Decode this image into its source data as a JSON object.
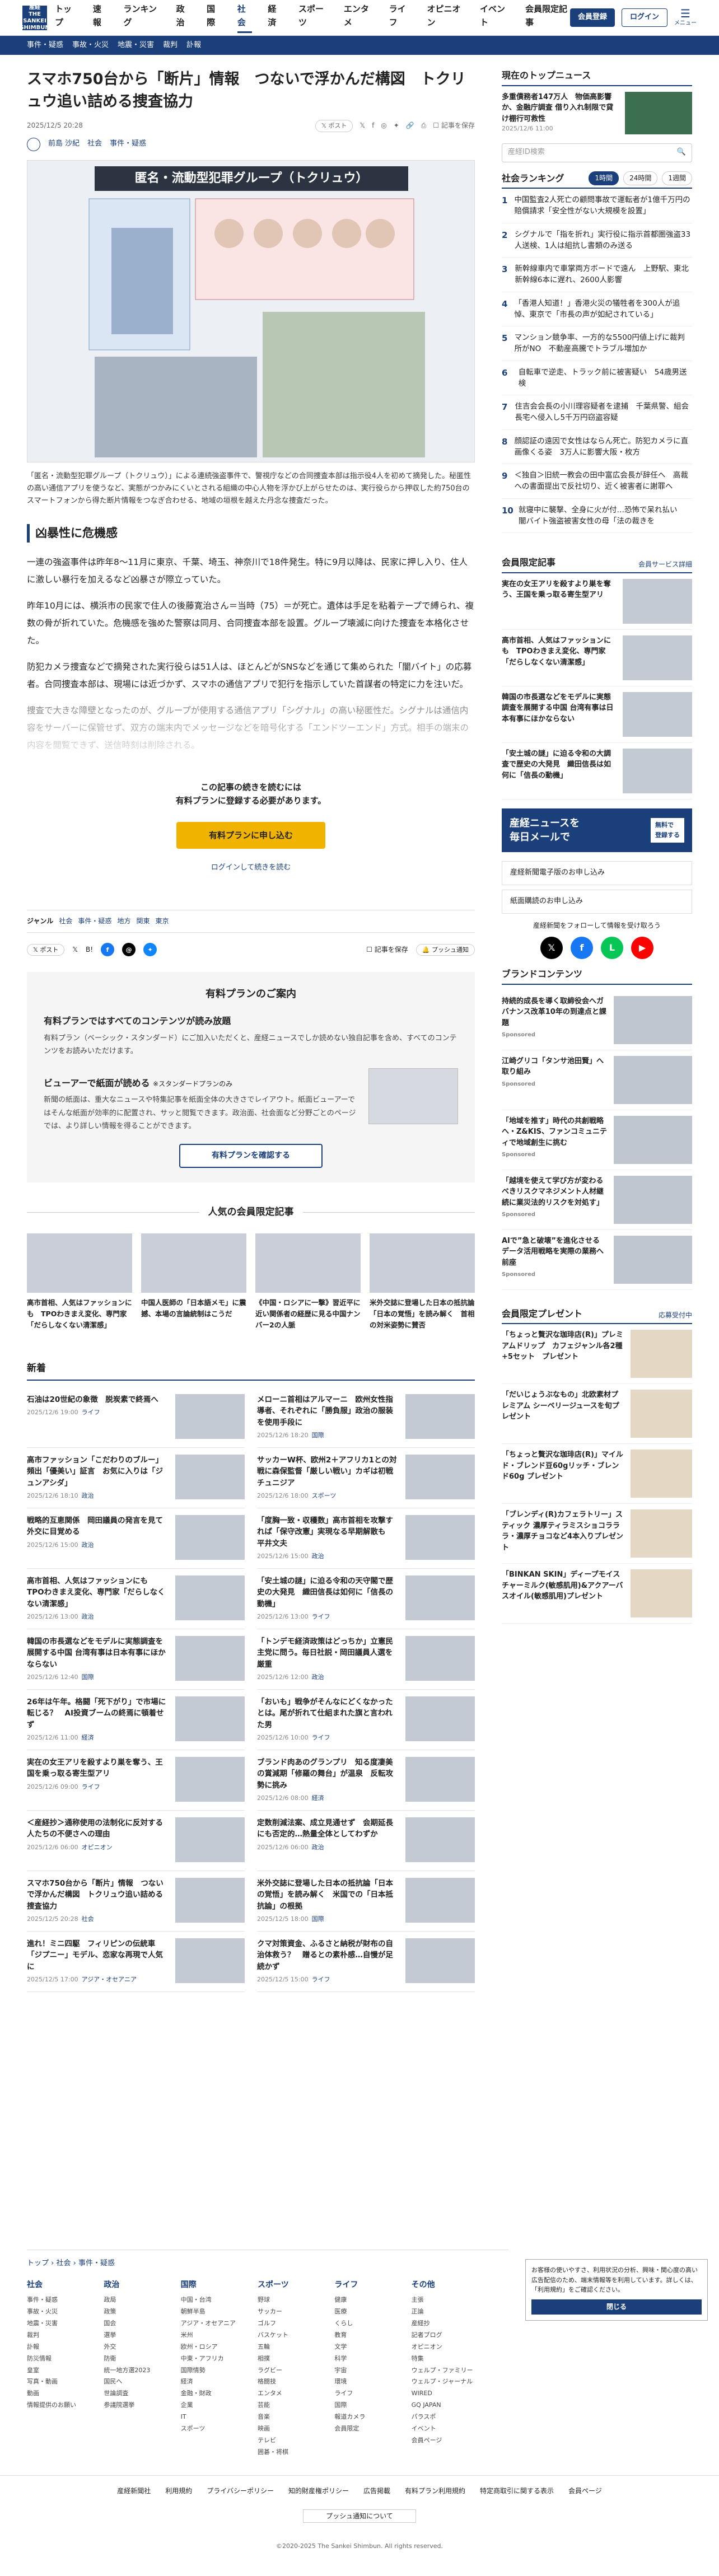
{
  "header": {
    "logo": "産経\nTHE SANKEI\nSHIMBUN",
    "nav": [
      "トップ",
      "速報",
      "ランキング",
      "政治",
      "国際",
      "社会",
      "経済",
      "スポーツ",
      "エンタメ",
      "ライフ",
      "オピニオン",
      "イベント",
      "会員限定記事"
    ],
    "current": "社会",
    "member_btn": "会員登録",
    "login_btn": "ログイン",
    "menu": "メニュー"
  },
  "subnav": [
    "事件・疑惑",
    "事故・火災",
    "地震・災害",
    "裁判",
    "訃報"
  ],
  "article": {
    "title": "スマホ750台から「断片」情報　つないで浮かんだ構図　トクリュウ追い詰める捜査協力",
    "date": "2025/12/5 20:28",
    "share": {
      "post": "ポスト",
      "save": "記事を保存"
    },
    "author": "前島 沙紀",
    "cats": [
      "社会",
      "事件・疑惑"
    ],
    "figure": {
      "banner": "匿名・流動型犯罪グループ（トクリュウ）",
      "caption": "「匿名・流動型犯罪グループ（トクリュウ）」による連続強盗事件で、警視庁などの合同捜査本部は指示役4人を初めて摘発した。秘匿性の高い通信アプリを使うなど、実態がつかみにくいとされる組織の中心人物を浮かび上がらせたのは、実行役らから押収した約750台のスマートフォンから得た断片情報をつなぎ合わせる、地域の垣根を越えた丹念な捜査だった。"
    },
    "h2": "凶暴性に危機感",
    "paras": [
      "一連の強盗事件は昨年8～11月に東京、千葉、埼玉、神奈川で18件発生。特に9月以降は、民家に押し入り、住人に激しい暴行を加えるなど凶暴さが際立っていた。",
      "昨年10月には、横浜市の民家で住人の後藤寛治さん＝当時（75）＝が死亡。遺体は手足を粘着テープで縛られ、複数の骨が折れていた。危機感を強めた警察は同月、合同捜査本部を設置。グループ壊滅に向けた捜査を本格化させた。",
      "防犯カメラ捜査などで摘発された実行役らは51人は、ほとんどがSNSなどを通じて集められた「闇バイト」の応募者。合同捜査本部は、現場には近づかず、スマホの通信アプリで犯行を指示していた首謀者の特定に力を注いだ。",
      "捜査で大きな障壁となったのが、グループが使用する通信アプリ「シグナル」の高い秘匿性だ。シグナルは通信内容をサーバーに保管せず、双方の端末内でメッセージなどを暗号化する「エンドツーエンド」方式。相手の端末の内容を閲覧できず、送信時刻は削除される。"
    ],
    "paywall": {
      "msg1": "この記事の続きを読むには",
      "msg2": "有料プランに登録する必要があります。",
      "btn": "有料プランに申し込む",
      "link": "ログインして続きを読む"
    },
    "genre": {
      "label": "ジャンル",
      "items": [
        "社会",
        "事件・疑惑",
        "地方",
        "関東",
        "東京"
      ]
    },
    "bshare": {
      "post": "ポスト",
      "save": "記事を保存",
      "flash": "プッシュ通知"
    }
  },
  "plan": {
    "title": "有料プランのご案内",
    "h1": "有料プランではすべてのコンテンツが読み放題",
    "p1": "有料プラン（ベーシック・スタンダード）にご加入いただくと、産経ニュースでしか読めない独自記事を含め、すべてのコンテンツをお読みいただけます。",
    "h2": "ビューアーで紙面が読める",
    "h2note": "※スタンダードプランのみ",
    "p2": "新聞の紙面は、重大なニュースや特集記事を紙面全体の大きさでレイアウト。紙面ビューアーではそんな紙面が効率的に配置され、サッと閲覧できます。政治面、社会面など分野ごとのページでは、より詳しい情報を得ることができます。",
    "btn": "有料プランを確認する"
  },
  "popular": {
    "title": "人気の会員限定記事",
    "items": [
      "高市首相、人気はファッションにも　TPOわきまえ変化、専門家「だらしなくない清潔感」",
      "中国人医師の「日本語メモ」に震撼、本場の言論統制はこうだ",
      "《中国・ロシアに一撃》習近平に近い関係者の経歴に見る中国ナンバー2の人脈",
      "米外交誌に登場した日本の抵抗論「日本の覚悟」を読み解く　首相の対米姿勢に賛否"
    ]
  },
  "news": {
    "title": "新着",
    "items": [
      {
        "t": "石油は20世紀の象徴　脱炭素で終焉へ",
        "d": "2025/12/6 19:00",
        "c": "ライフ"
      },
      {
        "t": "メローニ首相はアルマーニ　欧州女性指導者、それぞれに「勝負服」政治の服装を使用手段に",
        "d": "2025/12/6 18:20",
        "c": "国際"
      },
      {
        "t": "高市ファッション「こだわりのブルー」頻出「優美い」証言　お気に入りは「ジュンアシダ」",
        "d": "2025/12/6 18:10",
        "c": "政治"
      },
      {
        "t": "サッカーW杯、欧州2＋アフリカ1との対戦に森保監督「厳しい戦い」カギは初戦チュニジア",
        "d": "2025/12/6 18:00",
        "c": "スポーツ"
      },
      {
        "t": "戦略的互恵関係　岡田議員の発言を見て外交に目覚める",
        "d": "2025/12/6 15:00",
        "c": "政治"
      },
      {
        "t": "「度胸一致・収穫数」高市首相を攻撃すれば「保守改憲」実現なる早期解散も　平井文夫",
        "d": "2025/12/6 15:00",
        "c": "政治"
      },
      {
        "t": "高市首相、人気はファッションにも　TPOわきまえ変化、専門家「だらしなくない清潔感」",
        "d": "2025/12/6 13:00",
        "c": "政治"
      },
      {
        "t": "「安土城の謎」に迫る令和の天守閣で歴史の大発見　織田信長は如何に「信長の動機」",
        "d": "2025/12/6 13:00",
        "c": "ライフ"
      },
      {
        "t": "韓国の市長選などをモデルに実態調査を展開する中国 台湾有事は日本有事にほかならない",
        "d": "2025/12/6 12:40",
        "c": "国際"
      },
      {
        "t": "「トンデモ経済政策はどっちか」立憲民主党に問う。毎日社説・岡田議員人選を厳重",
        "d": "2025/12/6 12:00",
        "c": "政治"
      },
      {
        "t": "26年は午年。格闘「死下がり」で市場に転じる？　AI投資ブームの終焉に頓着せず",
        "d": "2025/12/6 11:00",
        "c": "経済"
      },
      {
        "t": "「おいも」戦争がそんなにどくなかったとは。尾が折れて仕組まれた旗と言われた男",
        "d": "2025/12/6 10:00",
        "c": "ライフ"
      },
      {
        "t": "実在の女王アリを殺すより巣を奪う、王国を乗っ取る寄生型アリ",
        "d": "2025/12/6 09:00",
        "c": "ライフ"
      },
      {
        "t": "ブランド肉あのグランプリ　知る度凄美の賞減期「修羅の舞台」が温泉　反転攻勢に挑み",
        "d": "2025/12/6 08:00",
        "c": "経済"
      },
      {
        "t": "＜産経抄＞通称使用の法制化に反対する人たちの不便さへの理由",
        "d": "2025/12/6 06:00",
        "c": "オピニオン"
      },
      {
        "t": "定数削減法案、成立見通せず　会期延長にも否定的…熱量全体としてわずか",
        "d": "2025/12/6 06:00",
        "c": "政治"
      },
      {
        "t": "スマホ750台から「断片」情報　つないで浮かんだ構図　トクリュウ追い詰める捜査協力",
        "d": "2025/12/5 20:28",
        "c": "社会"
      },
      {
        "t": "米外交誌に登場した日本の抵抗論「日本の覚悟」を読み解く　米国での「日本抵抗論」の根拠",
        "d": "2025/12/5 18:00",
        "c": "国際"
      },
      {
        "t": "進れ！ミニ四駆　フィリピンの伝統車「ジプニー」モデル、恋家な再現で人気に",
        "d": "2025/12/5 17:00",
        "c": "アジア・オセアニア"
      },
      {
        "t": "クマ対策資金、ふるさと納税が財布の自治体救う？　贈るとの素朴感…自慢が足続かず",
        "d": "2025/12/5 15:00",
        "c": "ライフ"
      }
    ]
  },
  "side": {
    "top_title": "現在のトップニュース",
    "top_news": "多重債務者147万人　物価高影響か、金融庁調査 借り入れ制限で貸け棚行可救性",
    "top_date": "2025/12/6 11:00",
    "search_placeholder": "産経ID検索",
    "rank_title": "社会ランキング",
    "rank_tabs": [
      "1時間",
      "24時間",
      "1週間"
    ],
    "ranking": [
      "中国監査2人死亡の顧問事故で運転者が1億千万円の賠償請求「安全性がない大規模を設置」",
      "シグナルで「指を折れ」実行役に指示首都圏強盗33人送検、1人は組抗し書類のみ送る",
      "新幹線車内で車掌両方ボードで遠ん　上野駅、東北新幹線6本に遅れ、2600人影響",
      "「香港人知道！」香港火災の犠牲者を300人が追悼、東京で「市長の声が如紀されている」",
      "マンション競争率、一方的な5500円値上げに裁判所がNO　不動産高騰でトラブル増加か",
      "自転車で逆走、トラック前に被害疑い　54歳男送検",
      "住吉会会長の小川理容疑者を逮捕　千葉県警、組会長宅へ侵入し5千万円窃盗容疑",
      "顔認証の遠因で女性はならん死亡。防犯カメラに直画像くる姿　3万人に影響大阪・枚方",
      "＜独自＞旧統一教会の田中富広会長が辞任へ　高裁への書面提出で反社切り、近く被害者に謝罪へ",
      "就寝中に襲撃、全身に火が付…恐怖で呆れ払い　闇バイト強盗被害女性の母「法の裁きを"
    ],
    "member_title": "会員限定記事",
    "member_more": "会員サービス詳細",
    "member_items": [
      "実在の女王アリを殺すより巣を奪う、王国を乗っ取る寄生型アリ",
      "高市首相、人気はファッションにも　TPOわきまえ変化、専門家「だらしなくない清潔感」",
      "韓国の市長選などをモデルに実態調査を展開する中国 台湾有事は日本有事にほかならない",
      "「安土城の謎」に迫る令和の大調査で歴史の大発見　織田信長は如何に「信長の動機」"
    ],
    "mail_big": "産経ニュースを\n毎日メールで",
    "mail_tag": "無料で\n登録する",
    "links": [
      "産経新聞電子版のお申し込み",
      "紙面購読のお申し込み"
    ],
    "social_title": "産経新聞をフォローして情報を受け取ろう",
    "brand_title": "ブランドコンテンツ",
    "brand": [
      {
        "t": "持続的成長を導く取締役会へガバナンス改革10年の到達点と課題",
        "s": "Sponsored"
      },
      {
        "t": "江崎グリコ「タンサ池田賢」へ取り組み",
        "s": "Sponsored"
      },
      {
        "t": "「地域を推す」時代の共創戦略へ・Z&KIS、ファンコミュニティで地域創生に挑む",
        "s": "Sponsored"
      },
      {
        "t": "「越境を使えて学び方が変わるべきリスクマネジメント人材継続に業災法的リスクを対処す」",
        "s": "Sponsored"
      },
      {
        "t": "AIで”急と破壊”を進化させる　データ活用戦略を実際の業務へ　前座",
        "s": "Sponsored"
      }
    ],
    "present_title": "会員限定プレゼント",
    "present_more": "応募受付中",
    "present": [
      "「ちょっと贅沢な珈琲店(R)」プレミアムドリップ　カフェジャンル各2種+5セット　プレゼント",
      "「だいじょうぶなもの」北欧素材プレミアム シーベリージュースを旬プレゼント",
      "「ちょっと贅沢な珈琲店(R)」マイルド・ブレンド豆60gリッチ・ブレンド60g プレゼント",
      "「ブレンディ(R)カフェラトリー」スティック 濃厚ティラミスショコラララ・濃厚チョコなど4本入りプレゼント",
      "「BINKAN SKIN」ディープモイスチャーミルク(敏感肌用)&アクアーバスオイル(敏感肌用)プレゼント"
    ],
    "cookie": "お客様の使いやすさ、利用状況の分析、興味・関心度の高い広告配信のため、端末情報等を利用しています。詳しくは、「利用規約」をご確認ください。",
    "cookie_ok": "閉じる"
  },
  "footer": {
    "crumb": [
      "トップ",
      "社会",
      "事件・疑惑"
    ],
    "cols": [
      {
        "h": "社会",
        "items": [
          "事件・疑惑",
          "事故・火災",
          "地震・災害",
          "裁判",
          "訃報",
          "防災情報",
          "皇室",
          "写真・動画",
          "動画",
          "情報提供のお願い"
        ]
      },
      {
        "h": "政治",
        "items": [
          "政局",
          "政策",
          "国会",
          "選挙",
          "外交",
          "防衛",
          "統一地方選2023",
          "国民へ",
          "世論調査",
          "参議院選挙"
        ]
      },
      {
        "h": "国際",
        "items": [
          "中国・台湾",
          "朝鮮半島",
          "アジア・オセアニア",
          "米州",
          "欧州・ロシア",
          "中東・アフリカ",
          "国際情勢",
          "経済",
          "金融・財政",
          "企業",
          "IT",
          "スポーツ"
        ]
      },
      {
        "h": "スポーツ",
        "items": [
          "野球",
          "サッカー",
          "ゴルフ",
          "バスケット",
          "五輪",
          "相撲",
          "ラグビー",
          "格闘技",
          "エンタメ",
          "芸能",
          "音楽",
          "映画",
          "テレビ",
          "囲碁・将棋"
        ]
      },
      {
        "h": "ライフ",
        "items": [
          "健康",
          "医療",
          "くらし",
          "教育",
          "文学",
          "科学",
          "宇宙",
          "環境",
          "ライフ",
          "国際",
          "報道カメラ",
          "会員限定"
        ]
      },
      {
        "h": "その他",
        "items": [
          "主張",
          "正論",
          "産経抄",
          "記者ブログ",
          "オピニオン",
          "特集",
          "ウェルプ・ファミリー",
          "ウェルプ・ジャーナル",
          "WIRED",
          "GQ JAPAN",
          "パラスポ",
          "イベント",
          "会員ページ"
        ]
      }
    ],
    "links": [
      "産経新聞社",
      "利用規約",
      "プライバシーポリシー",
      "知的財産権ポリシー",
      "広告掲載",
      "有料プラン利用規約",
      "特定商取引に関する表示",
      "会員ページ"
    ],
    "push": "プッシュ通知について",
    "copy": "©2020-2025 The Sankei Shimbun. All rights reserved."
  }
}
